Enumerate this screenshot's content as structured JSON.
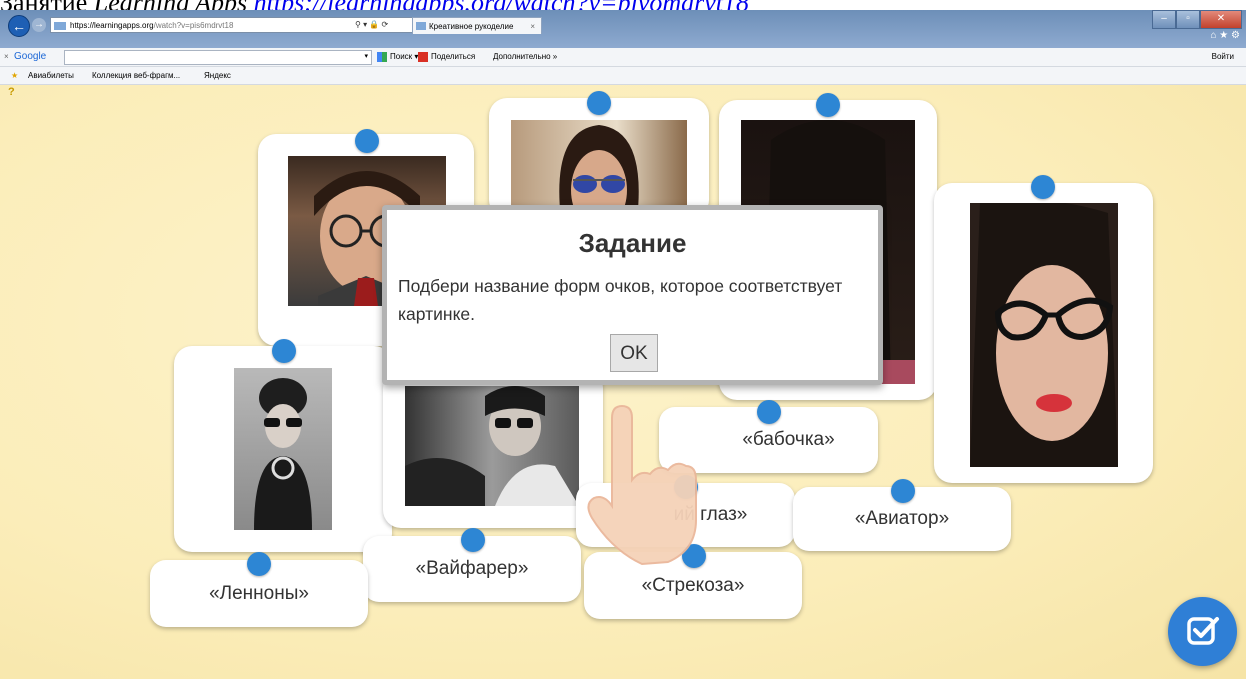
{
  "doc_caption": {
    "prefix": "Занятие ",
    "app_name": "Learning Apps",
    "link": "https://learningapps.org/watch?v=pivomdrvt18"
  },
  "browser": {
    "url_host": "https://learningapps.org",
    "url_path": "/watch?v=pis6mdrvt18",
    "tab_title": "Креативное рукоделие",
    "tab_close": "×",
    "back_glyph": "←",
    "forward_glyph": "→",
    "window_buttons": [
      "–",
      "▫",
      "✕"
    ],
    "right_icons": "⌂ ★ ⚙"
  },
  "google_toolbar": {
    "close": "×",
    "logo": "Google",
    "search_label": "Поиск",
    "share_label": "Поделиться",
    "more_label": "Дополнительно »",
    "login_label": "Войти"
  },
  "favorites": {
    "items": [
      "Авиабилеты",
      "Коллекция веб-фрагм...",
      "Яндекс"
    ]
  },
  "dialog": {
    "title": "Задание",
    "text": "Подбери название форм очков, которое соответствует картинке.",
    "ok_label": "OK"
  },
  "labels": {
    "babochka": "«бабочка»",
    "koshachiy": "ий глаз»",
    "aviator": "«Авиатор»",
    "vayfarer": "«Вайфарер»",
    "lennony": "«Ленноны»",
    "strekoza": "«Стрекоза»"
  },
  "colors": {
    "pin": "#2d86d4",
    "check_button": "#2f7fd6",
    "stage_background": "#fbedb9"
  },
  "icons": {
    "check_button": "check-square-icon",
    "hand": "pointing-hand-icon",
    "help": "question-icon"
  }
}
